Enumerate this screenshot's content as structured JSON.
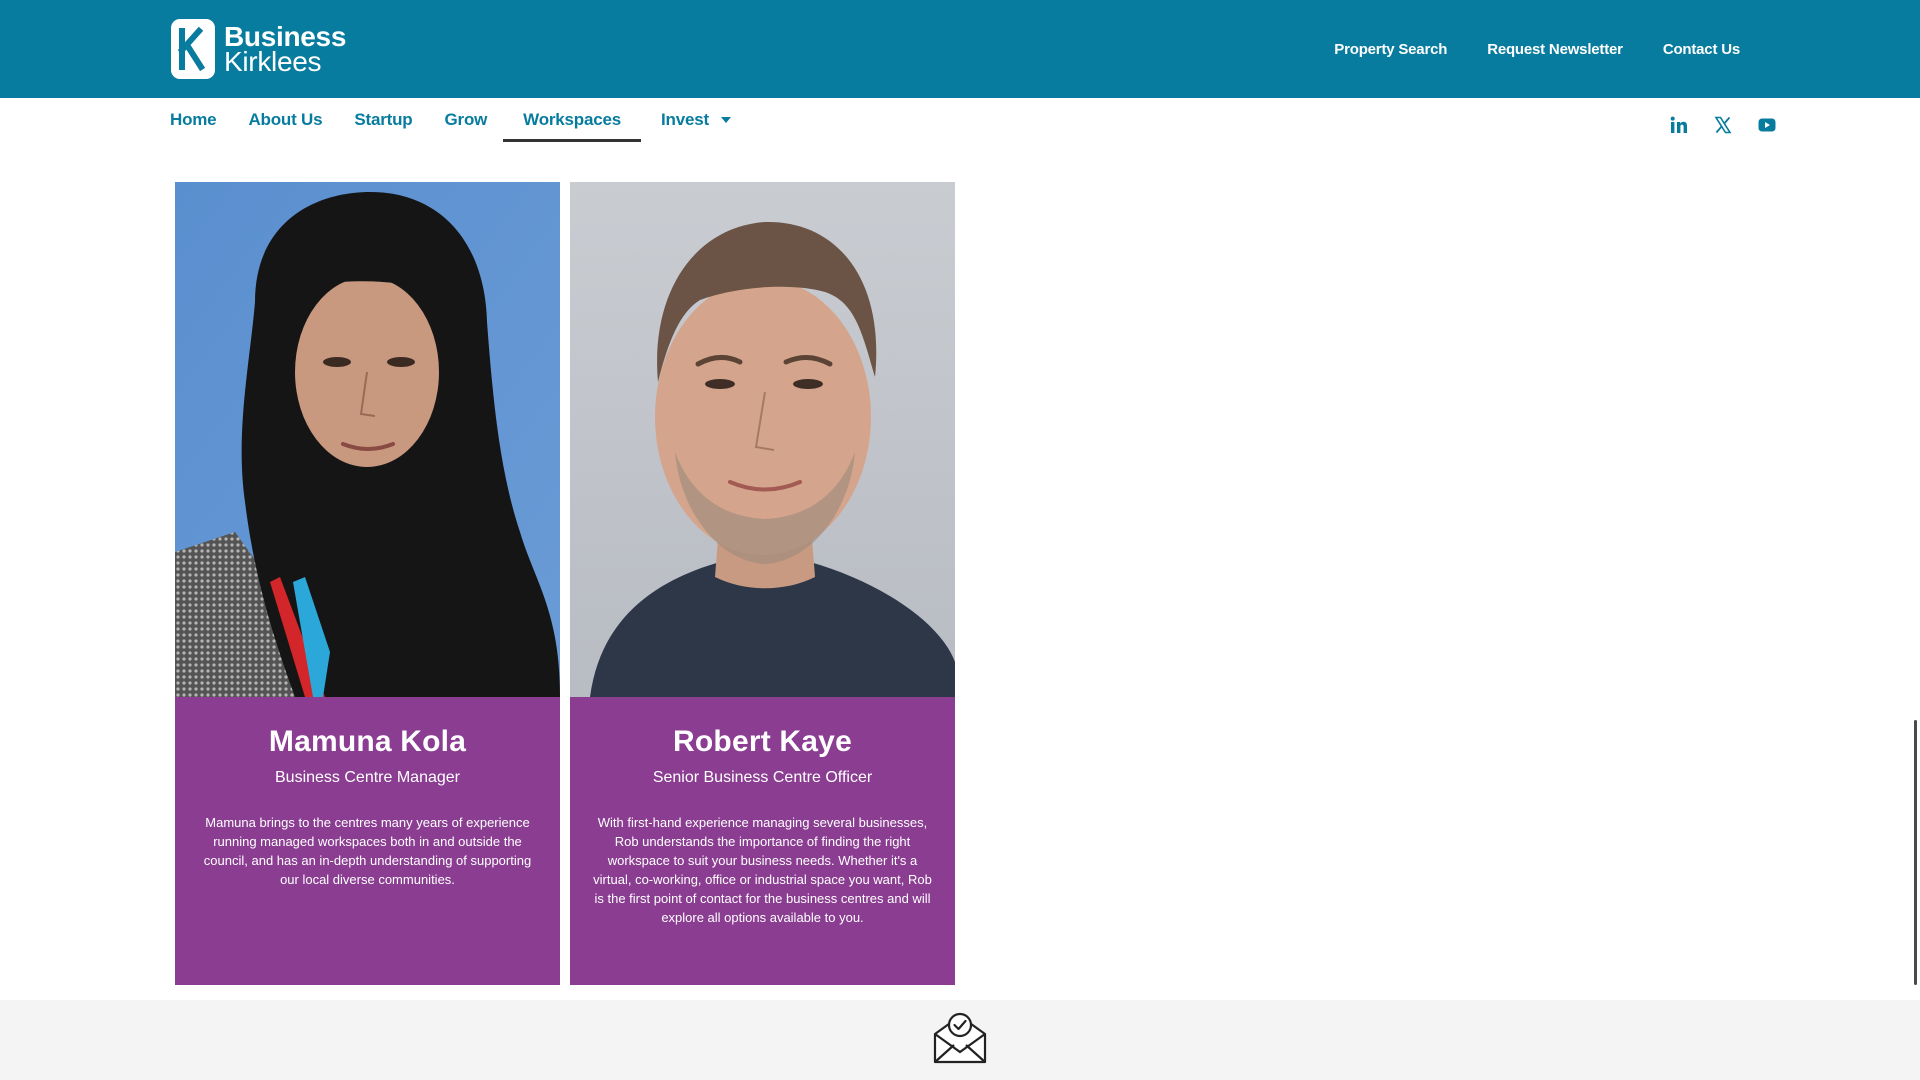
{
  "logo": {
    "line1": "Business",
    "line2": "Kirklees"
  },
  "top_links": [
    "Property Search",
    "Request Newsletter",
    "Contact Us"
  ],
  "nav": {
    "items": [
      "Home",
      "About Us",
      "Startup",
      "Grow",
      "Workspaces",
      "Invest"
    ],
    "active": "Workspaces"
  },
  "social": [
    "linkedin-icon",
    "x-icon",
    "youtube-icon"
  ],
  "team": [
    {
      "name": "Mamuna Kola",
      "role": "Business Centre Manager",
      "bio": "Mamuna brings to the centres many years of experience running managed workspaces both in and outside the council, and has an in-depth understanding of supporting our local diverse communities."
    },
    {
      "name": "Robert Kaye",
      "role": "Senior Business Centre Officer",
      "bio": "With first-hand experience managing several businesses, Rob understands the importance of finding the right workspace to suit your business needs. Whether it's a virtual, co-working, office or industrial space you want, Rob is the first point of contact for the business centres and will explore all options available to you."
    }
  ],
  "colors": {
    "brand_teal": "#087c9f",
    "card_purple": "#8a3d91",
    "footer_bg": "#f4f4f4"
  }
}
